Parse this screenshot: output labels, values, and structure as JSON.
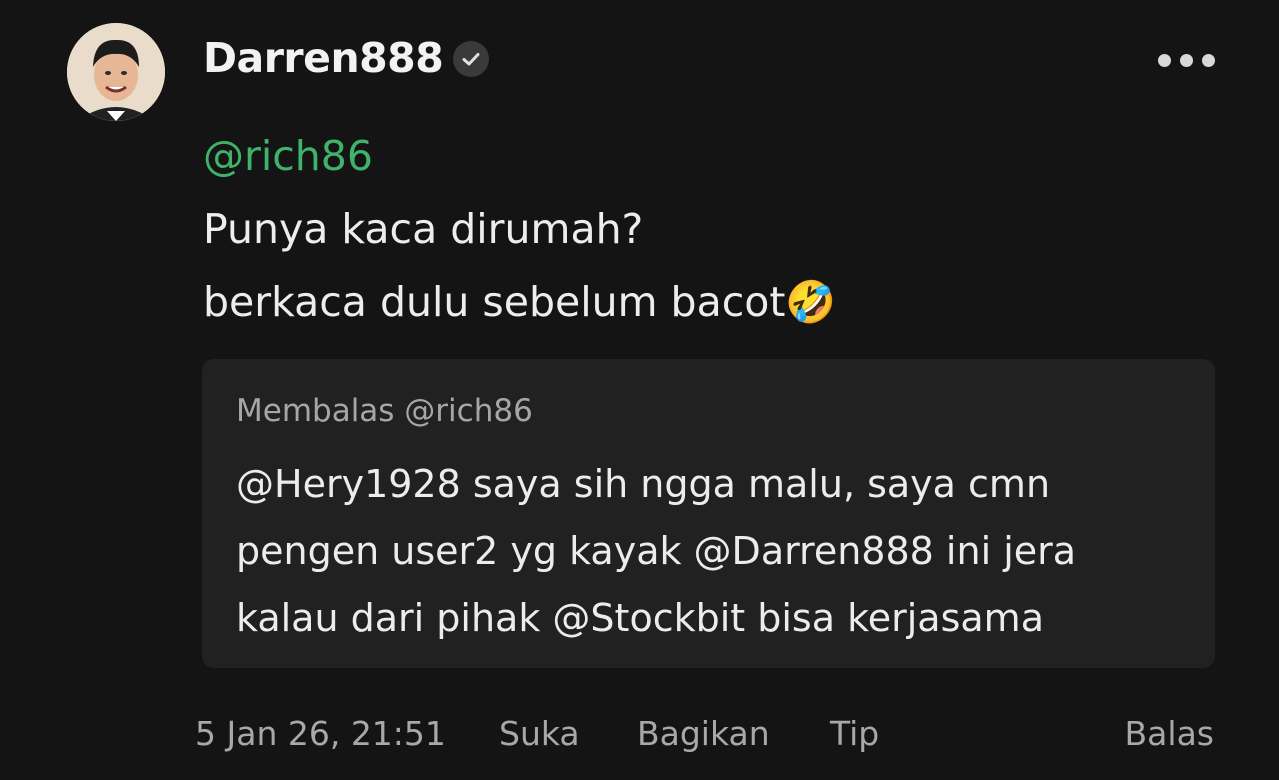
{
  "post": {
    "username": "Darren888",
    "verified_icon": "verified-check-icon",
    "more_icon": "more-horizontal-icon",
    "mention": "@rich86",
    "lines": [
      "Punya kaca dirumah?",
      "berkaca dulu sebelum bacot"
    ],
    "emoji": "🤣"
  },
  "reply_quote": {
    "label": "Membalas @rich86",
    "lines": [
      "@Hery1928 saya sih ngga malu, saya cmn",
      "pengen user2 yg kayak @Darren888 ini jera",
      "kalau dari pihak @Stockbit bisa kerjasama"
    ]
  },
  "footer": {
    "timestamp": "5 Jan 26, 21:51",
    "like_label": "Suka",
    "share_label": "Bagikan",
    "tip_label": "Tip",
    "reply_label": "Balas"
  },
  "colors": {
    "background": "#141414",
    "mention": "#3fb36b",
    "quote_background": "#212121",
    "muted_text": "#a8a8a8"
  }
}
